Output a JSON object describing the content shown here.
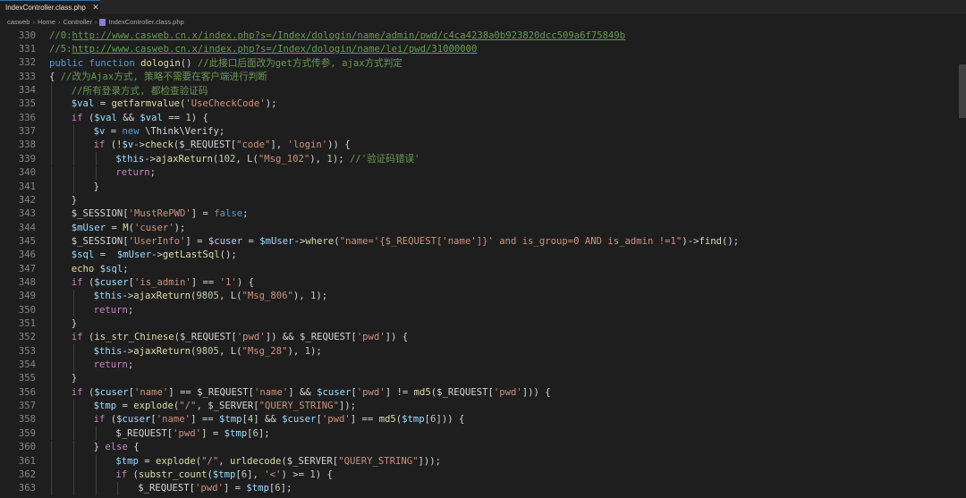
{
  "tab": {
    "label": "IndexController.class.php",
    "close_glyph": "✕"
  },
  "breadcrumb": [
    "casweb",
    "Home",
    "Controller",
    "IndexController.class.php"
  ],
  "colors": {
    "comment": "#6a9955",
    "keyword": "#569cd6",
    "function": "#dcdcaa",
    "string": "#ce9178",
    "variable": "#9cdcfe",
    "number": "#b5cea8",
    "control": "#c586c0",
    "plain": "#d4d4d4"
  },
  "lines": [
    {
      "n": "330",
      "indent": 1,
      "tokens": [
        [
          "comment",
          "//0:"
        ],
        [
          "link",
          "http://www.casweb.cn.x/index.php?s=/Index/dologin/name/admin/pwd/c4ca4238a0b923820dcc509a6f75849b"
        ]
      ]
    },
    {
      "n": "331",
      "indent": 1,
      "tokens": [
        [
          "comment",
          "//5:"
        ],
        [
          "link",
          "http://www.casweb.cn.x/index.php?s=/Index/dologin/name/lei/pwd/31000000"
        ]
      ]
    },
    {
      "n": "332",
      "indent": 1,
      "tokens": [
        [
          "kw",
          "public"
        ],
        [
          "plain",
          " "
        ],
        [
          "kw",
          "function"
        ],
        [
          "plain",
          " "
        ],
        [
          "fn",
          "dologin"
        ],
        [
          "plain",
          "() "
        ],
        [
          "comment",
          "//此接口后面改为get方式传参, ajax方式判定"
        ]
      ]
    },
    {
      "n": "333",
      "indent": 1,
      "tokens": [
        [
          "plain",
          "{ "
        ],
        [
          "comment",
          "//改为Ajax方式, 策略不需要在客户端进行判断"
        ]
      ]
    },
    {
      "n": "334",
      "indent": 2,
      "tokens": [
        [
          "comment",
          "//所有登录方式, 都检查验证码"
        ]
      ]
    },
    {
      "n": "335",
      "indent": 2,
      "tokens": [
        [
          "var",
          "$val"
        ],
        [
          "plain",
          " = "
        ],
        [
          "fn",
          "getfarmvalue"
        ],
        [
          "plain",
          "("
        ],
        [
          "str",
          "'UseCheckCode'"
        ],
        [
          "plain",
          ");"
        ]
      ]
    },
    {
      "n": "336",
      "indent": 2,
      "tokens": [
        [
          "ctrl",
          "if"
        ],
        [
          "plain",
          " ("
        ],
        [
          "var",
          "$val"
        ],
        [
          "plain",
          " && "
        ],
        [
          "var",
          "$val"
        ],
        [
          "plain",
          " == "
        ],
        [
          "num",
          "1"
        ],
        [
          "plain",
          ") {"
        ]
      ]
    },
    {
      "n": "337",
      "indent": 3,
      "tokens": [
        [
          "var",
          "$v"
        ],
        [
          "plain",
          " = "
        ],
        [
          "kw",
          "new"
        ],
        [
          "plain",
          " \\Think\\Verify;"
        ]
      ]
    },
    {
      "n": "338",
      "indent": 3,
      "tokens": [
        [
          "ctrl",
          "if"
        ],
        [
          "plain",
          " (!"
        ],
        [
          "var",
          "$v"
        ],
        [
          "plain",
          "->"
        ],
        [
          "fn",
          "check"
        ],
        [
          "plain",
          "($_REQUEST["
        ],
        [
          "str",
          "\"code\""
        ],
        [
          "plain",
          "], "
        ],
        [
          "str",
          "'login'"
        ],
        [
          "plain",
          ")) {"
        ]
      ]
    },
    {
      "n": "339",
      "indent": 4,
      "tokens": [
        [
          "var",
          "$this"
        ],
        [
          "plain",
          "->"
        ],
        [
          "fn",
          "ajaxReturn"
        ],
        [
          "plain",
          "("
        ],
        [
          "num",
          "102"
        ],
        [
          "plain",
          ", L("
        ],
        [
          "str",
          "\"Msg_102\""
        ],
        [
          "plain",
          "), "
        ],
        [
          "num",
          "1"
        ],
        [
          "plain",
          "); "
        ],
        [
          "comment",
          "//'验证码错误'"
        ]
      ]
    },
    {
      "n": "340",
      "indent": 4,
      "tokens": [
        [
          "ctrl",
          "return"
        ],
        [
          "plain",
          ";"
        ]
      ]
    },
    {
      "n": "341",
      "indent": 3,
      "tokens": [
        [
          "plain",
          "}"
        ]
      ]
    },
    {
      "n": "342",
      "indent": 2,
      "tokens": [
        [
          "plain",
          "}"
        ]
      ]
    },
    {
      "n": "343",
      "indent": 2,
      "tokens": [
        [
          "plain",
          "$_SESSION["
        ],
        [
          "str",
          "'MustRePWD'"
        ],
        [
          "plain",
          "] = "
        ],
        [
          "kw",
          "false"
        ],
        [
          "plain",
          ";"
        ]
      ]
    },
    {
      "n": "344",
      "indent": 2,
      "tokens": [
        [
          "var",
          "$mUser"
        ],
        [
          "plain",
          " = "
        ],
        [
          "fn",
          "M"
        ],
        [
          "plain",
          "("
        ],
        [
          "str",
          "'cuser'"
        ],
        [
          "plain",
          ");"
        ]
      ]
    },
    {
      "n": "345",
      "indent": 2,
      "tokens": [
        [
          "plain",
          "$_SESSION["
        ],
        [
          "str",
          "'UserInfo'"
        ],
        [
          "plain",
          "] = "
        ],
        [
          "var",
          "$cuser"
        ],
        [
          "plain",
          " = "
        ],
        [
          "var",
          "$mUser"
        ],
        [
          "plain",
          "->"
        ],
        [
          "fn",
          "where"
        ],
        [
          "plain",
          "("
        ],
        [
          "str",
          "\"name='{$_REQUEST['name']}' and is_group=0 AND is_admin !=1\""
        ],
        [
          "plain",
          ")->"
        ],
        [
          "fn",
          "find"
        ],
        [
          "plain",
          "();"
        ]
      ]
    },
    {
      "n": "346",
      "indent": 2,
      "tokens": [
        [
          "var",
          "$sql"
        ],
        [
          "plain",
          " =  "
        ],
        [
          "var",
          "$mUser"
        ],
        [
          "plain",
          "->"
        ],
        [
          "fn",
          "getLastSql"
        ],
        [
          "plain",
          "();"
        ]
      ]
    },
    {
      "n": "347",
      "indent": 2,
      "tokens": [
        [
          "fn",
          "echo"
        ],
        [
          "plain",
          " "
        ],
        [
          "var",
          "$sql"
        ],
        [
          "plain",
          ";"
        ]
      ]
    },
    {
      "n": "348",
      "indent": 2,
      "tokens": [
        [
          "ctrl",
          "if"
        ],
        [
          "plain",
          " ("
        ],
        [
          "var",
          "$cuser"
        ],
        [
          "plain",
          "["
        ],
        [
          "str",
          "'is_admin'"
        ],
        [
          "plain",
          "] == "
        ],
        [
          "str",
          "'1'"
        ],
        [
          "plain",
          ") {"
        ]
      ]
    },
    {
      "n": "349",
      "indent": 3,
      "tokens": [
        [
          "var",
          "$this"
        ],
        [
          "plain",
          "->"
        ],
        [
          "fn",
          "ajaxReturn"
        ],
        [
          "plain",
          "("
        ],
        [
          "num",
          "9805"
        ],
        [
          "plain",
          ", L("
        ],
        [
          "str",
          "\"Msg_806\""
        ],
        [
          "plain",
          "), "
        ],
        [
          "num",
          "1"
        ],
        [
          "plain",
          ");"
        ]
      ]
    },
    {
      "n": "350",
      "indent": 3,
      "tokens": [
        [
          "ctrl",
          "return"
        ],
        [
          "plain",
          ";"
        ]
      ]
    },
    {
      "n": "351",
      "indent": 2,
      "tokens": [
        [
          "plain",
          "}"
        ]
      ]
    },
    {
      "n": "352",
      "indent": 2,
      "tokens": [
        [
          "ctrl",
          "if"
        ],
        [
          "plain",
          " ("
        ],
        [
          "fn",
          "is_str_Chinese"
        ],
        [
          "plain",
          "($_REQUEST["
        ],
        [
          "str",
          "'pwd'"
        ],
        [
          "plain",
          "]) && $_REQUEST["
        ],
        [
          "str",
          "'pwd'"
        ],
        [
          "plain",
          "]) {"
        ]
      ]
    },
    {
      "n": "353",
      "indent": 3,
      "tokens": [
        [
          "var",
          "$this"
        ],
        [
          "plain",
          "->"
        ],
        [
          "fn",
          "ajaxReturn"
        ],
        [
          "plain",
          "("
        ],
        [
          "num",
          "9805"
        ],
        [
          "plain",
          ", L("
        ],
        [
          "str",
          "\"Msg_28\""
        ],
        [
          "plain",
          "), "
        ],
        [
          "num",
          "1"
        ],
        [
          "plain",
          ");"
        ]
      ]
    },
    {
      "n": "354",
      "indent": 3,
      "tokens": [
        [
          "ctrl",
          "return"
        ],
        [
          "plain",
          ";"
        ]
      ]
    },
    {
      "n": "355",
      "indent": 2,
      "tokens": [
        [
          "plain",
          "}"
        ]
      ]
    },
    {
      "n": "356",
      "indent": 2,
      "tokens": [
        [
          "ctrl",
          "if"
        ],
        [
          "plain",
          " ("
        ],
        [
          "var",
          "$cuser"
        ],
        [
          "plain",
          "["
        ],
        [
          "str",
          "'name'"
        ],
        [
          "plain",
          "] == $_REQUEST["
        ],
        [
          "str",
          "'name'"
        ],
        [
          "plain",
          "] && "
        ],
        [
          "var",
          "$cuser"
        ],
        [
          "plain",
          "["
        ],
        [
          "str",
          "'pwd'"
        ],
        [
          "plain",
          "] != "
        ],
        [
          "fn",
          "md5"
        ],
        [
          "plain",
          "($_REQUEST["
        ],
        [
          "str",
          "'pwd'"
        ],
        [
          "plain",
          "])) {"
        ]
      ]
    },
    {
      "n": "357",
      "indent": 3,
      "tokens": [
        [
          "var",
          "$tmp"
        ],
        [
          "plain",
          " = "
        ],
        [
          "fn",
          "explode"
        ],
        [
          "plain",
          "("
        ],
        [
          "str",
          "\"/\""
        ],
        [
          "plain",
          ", $_SERVER["
        ],
        [
          "str",
          "\"QUERY_STRING\""
        ],
        [
          "plain",
          "]);"
        ]
      ]
    },
    {
      "n": "358",
      "indent": 3,
      "tokens": [
        [
          "ctrl",
          "if"
        ],
        [
          "plain",
          " ("
        ],
        [
          "var",
          "$cuser"
        ],
        [
          "plain",
          "["
        ],
        [
          "str",
          "'name'"
        ],
        [
          "plain",
          "] == "
        ],
        [
          "var",
          "$tmp"
        ],
        [
          "plain",
          "["
        ],
        [
          "num",
          "4"
        ],
        [
          "plain",
          "] && "
        ],
        [
          "var",
          "$cuser"
        ],
        [
          "plain",
          "["
        ],
        [
          "str",
          "'pwd'"
        ],
        [
          "plain",
          "] == "
        ],
        [
          "fn",
          "md5"
        ],
        [
          "plain",
          "("
        ],
        [
          "var",
          "$tmp"
        ],
        [
          "plain",
          "["
        ],
        [
          "num",
          "6"
        ],
        [
          "plain",
          "])) {"
        ]
      ]
    },
    {
      "n": "359",
      "indent": 4,
      "tokens": [
        [
          "plain",
          "$_REQUEST["
        ],
        [
          "str",
          "'pwd'"
        ],
        [
          "plain",
          "] = "
        ],
        [
          "var",
          "$tmp"
        ],
        [
          "plain",
          "["
        ],
        [
          "num",
          "6"
        ],
        [
          "plain",
          "];"
        ]
      ]
    },
    {
      "n": "360",
      "indent": 3,
      "tokens": [
        [
          "plain",
          "} "
        ],
        [
          "ctrl",
          "else"
        ],
        [
          "plain",
          " {"
        ]
      ]
    },
    {
      "n": "361",
      "indent": 4,
      "tokens": [
        [
          "var",
          "$tmp"
        ],
        [
          "plain",
          " = "
        ],
        [
          "fn",
          "explode"
        ],
        [
          "plain",
          "("
        ],
        [
          "str",
          "\"/\""
        ],
        [
          "plain",
          ", "
        ],
        [
          "fn",
          "urldecode"
        ],
        [
          "plain",
          "($_SERVER["
        ],
        [
          "str",
          "\"QUERY_STRING\""
        ],
        [
          "plain",
          "]));"
        ]
      ]
    },
    {
      "n": "362",
      "indent": 4,
      "tokens": [
        [
          "ctrl",
          "if"
        ],
        [
          "plain",
          " ("
        ],
        [
          "fn",
          "substr_count"
        ],
        [
          "plain",
          "("
        ],
        [
          "var",
          "$tmp"
        ],
        [
          "plain",
          "["
        ],
        [
          "num",
          "6"
        ],
        [
          "plain",
          "], "
        ],
        [
          "str",
          "'<'"
        ],
        [
          "plain",
          ") >= "
        ],
        [
          "num",
          "1"
        ],
        [
          "plain",
          ") {"
        ]
      ]
    },
    {
      "n": "363",
      "indent": 5,
      "tokens": [
        [
          "plain",
          "$_REQUEST["
        ],
        [
          "str",
          "'pwd'"
        ],
        [
          "plain",
          "] = "
        ],
        [
          "var",
          "$tmp"
        ],
        [
          "plain",
          "["
        ],
        [
          "num",
          "6"
        ],
        [
          "plain",
          "];"
        ]
      ]
    }
  ]
}
